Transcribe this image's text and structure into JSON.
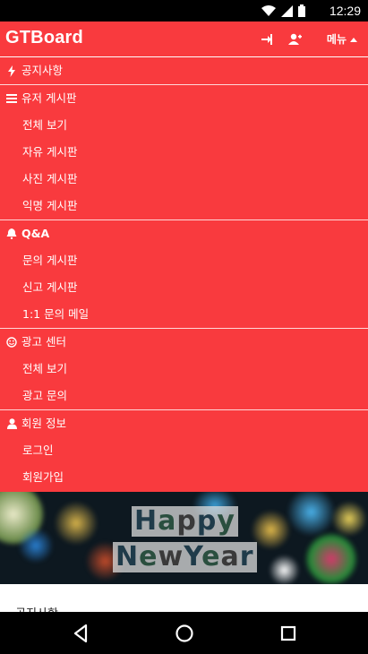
{
  "status": {
    "time": "12:29"
  },
  "header": {
    "brand": "GTBoard",
    "menu_label": "메뉴"
  },
  "nav": {
    "notice": "공지사항",
    "user_board": {
      "title": "유저 게시판",
      "items": [
        "전체 보기",
        "자유 게시판",
        "사진 게시판",
        "익명 게시판"
      ]
    },
    "qna": {
      "title": "Q&A",
      "items": [
        "문의 게시판",
        "신고 게시판",
        "1:1 문의 메일"
      ]
    },
    "ad_center": {
      "title": "광고 센터",
      "items": [
        "전체 보기",
        "광고 문의"
      ]
    },
    "member": {
      "title": "회원 정보",
      "items": [
        "로그인",
        "회원가입"
      ]
    }
  },
  "banner": {
    "line1": "Happy",
    "line2": "NewYear"
  },
  "content": {
    "section_title": "공지사항"
  },
  "colors": {
    "accent": "#f93a3e"
  }
}
